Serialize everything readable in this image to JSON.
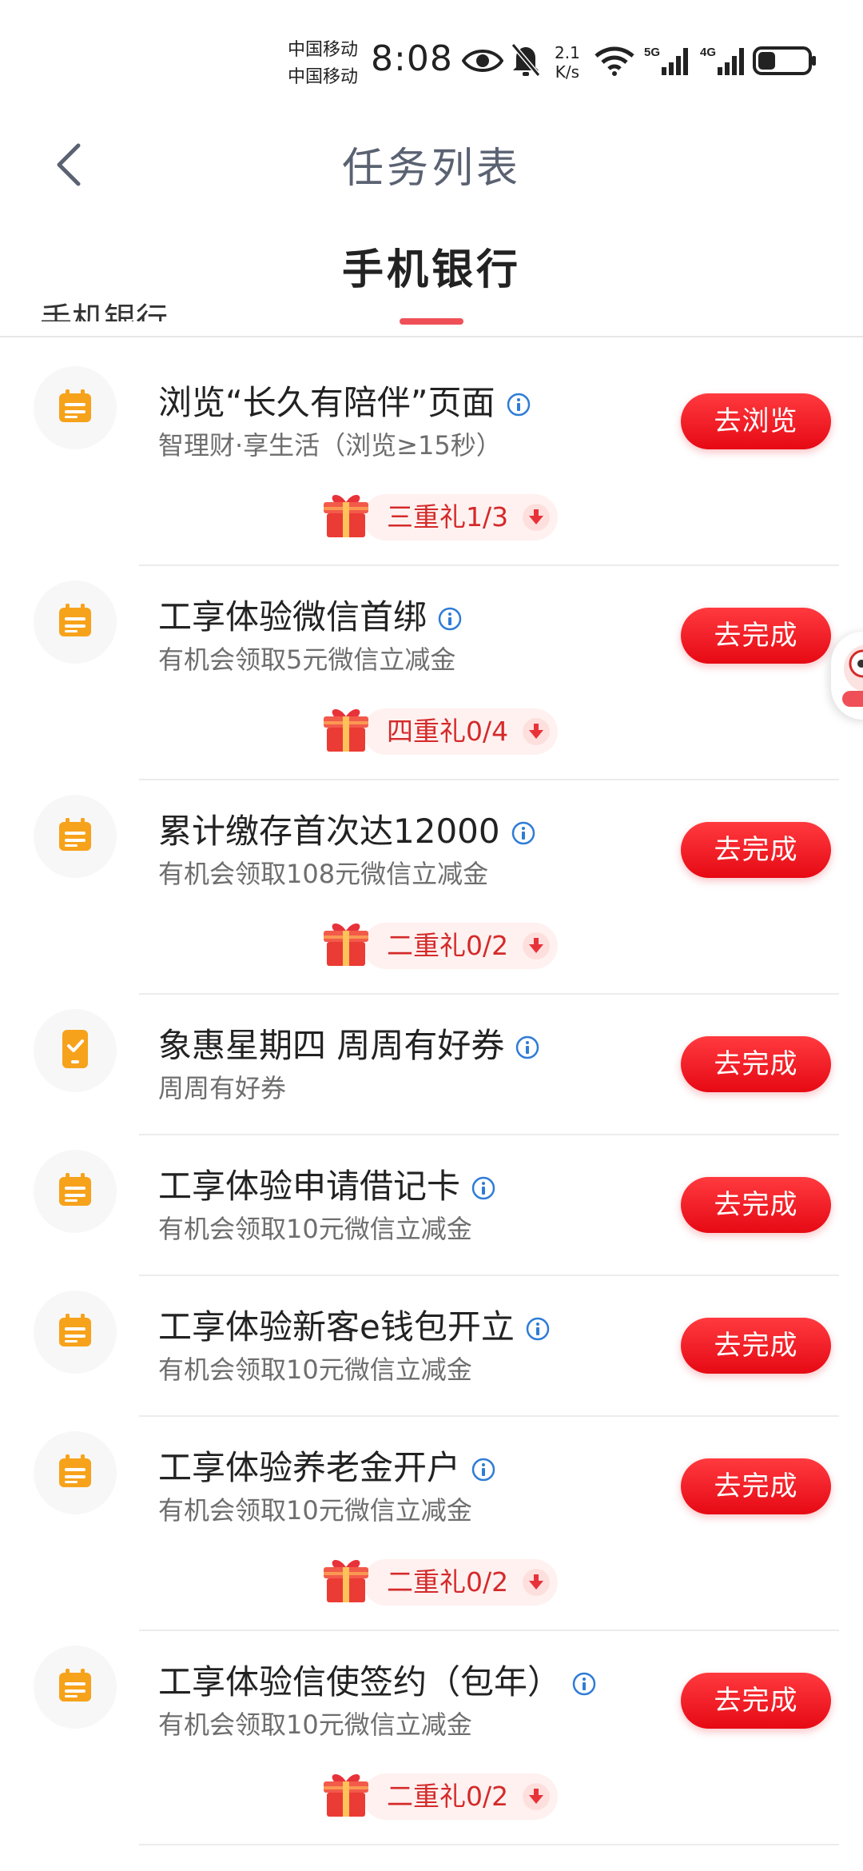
{
  "status_bar": {
    "carrier_1": "中国移动",
    "carrier_2": "中国移动",
    "time": "8:08",
    "net_speed_value": "2.1",
    "net_speed_unit": "K/s",
    "signal_1_label": "5G",
    "signal_2_label": "4G",
    "battery_level": 0.35
  },
  "header": {
    "title": "任务列表",
    "back_icon": "chevron-left-icon"
  },
  "tabs": [
    {
      "label": "手机银行",
      "active": true
    }
  ],
  "peek_section_label": "手机银行",
  "colors": {
    "accent": "#E60914",
    "tab_underline": "#EF5058",
    "task_icon": "#F7A21B",
    "info_icon": "#2F7CD6",
    "reward_text": "#D42A2A"
  },
  "tasks": [
    {
      "title": "浏览“长久有陪伴”页面",
      "desc": "智理财·享生活（浏览≥15秒）",
      "button": "去浏览",
      "reward": "三重礼1/3",
      "icon": "calendar-icon"
    },
    {
      "title": "工享体验微信首绑",
      "desc": "有机会领取5元微信立减金",
      "button": "去完成",
      "reward": "四重礼0/4",
      "icon": "calendar-icon"
    },
    {
      "title": "累计缴存首次达12000",
      "desc": "有机会领取108元微信立减金",
      "button": "去完成",
      "reward": "二重礼0/2",
      "icon": "calendar-icon"
    },
    {
      "title": "象惠星期四 周周有好券",
      "desc": "周周有好券",
      "button": "去完成",
      "reward": null,
      "icon": "phone-check-icon"
    },
    {
      "title": "工享体验申请借记卡",
      "desc": "有机会领取10元微信立减金",
      "button": "去完成",
      "reward": null,
      "icon": "calendar-icon"
    },
    {
      "title": "工享体验新客e钱包开立",
      "desc": "有机会领取10元微信立减金",
      "button": "去完成",
      "reward": null,
      "icon": "calendar-icon"
    },
    {
      "title": "工享体验养老金开户",
      "desc": "有机会领取10元微信立减金",
      "button": "去完成",
      "reward": "二重礼0/2",
      "icon": "calendar-icon"
    },
    {
      "title": "工享体验信使签约（包年）",
      "desc": "有机会领取10元微信立减金",
      "button": "去完成",
      "reward": "二重礼0/2",
      "icon": "calendar-icon"
    }
  ]
}
